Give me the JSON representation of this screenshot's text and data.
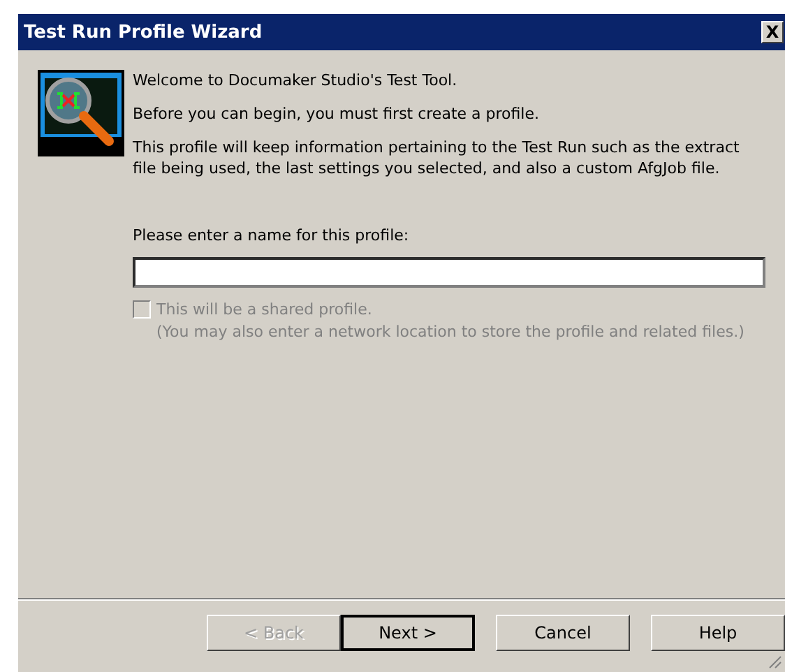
{
  "window": {
    "title": "Test Run Profile Wizard",
    "close_glyph": "X"
  },
  "intro": [
    "Welcome to Documaker Studio's Test Tool.",
    "Before you can begin, you must first create a profile.",
    "This profile will keep information pertaining to the Test Run such as the extract file being used, the last settings you selected, and also a custom AfgJob file."
  ],
  "name_field": {
    "label": "Please enter a name for this profile:"
  },
  "shared": {
    "label": "This will be a shared profile.",
    "note": "(You may also enter a network location to store the profile and related files.)",
    "checked": false,
    "disabled": true
  },
  "buttons": [
    {
      "label": "< Back",
      "disabled": true,
      "default": false
    },
    {
      "label": "Next >",
      "disabled": false,
      "default": true
    },
    {
      "label": "Cancel",
      "disabled": false,
      "default": false
    },
    {
      "label": "Help",
      "disabled": false,
      "default": false
    }
  ]
}
